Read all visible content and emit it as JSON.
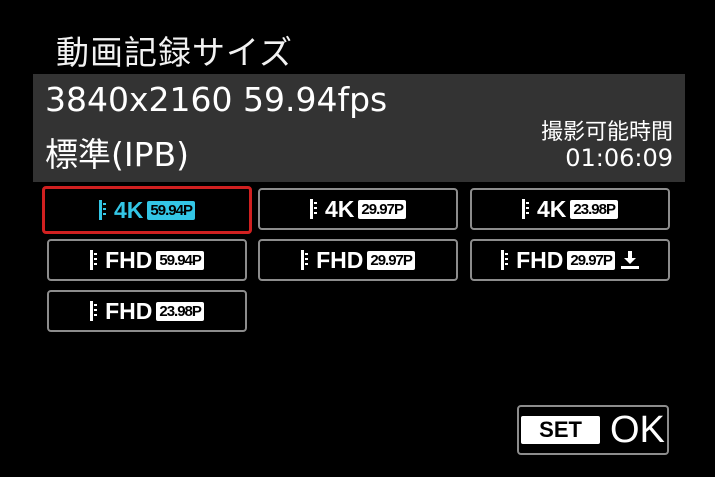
{
  "menu": {
    "title": "動画記録サイズ"
  },
  "info": {
    "resolution_fps": "3840x2160 59.94fps",
    "quality": "標準(IPB)",
    "rec_time_label": "撮影可能時間",
    "rec_time_value": "01:06:09"
  },
  "options": [
    {
      "res": "4K",
      "fps": "59.94P",
      "selected": true
    },
    {
      "res": "4K",
      "fps": "29.97P",
      "selected": false
    },
    {
      "res": "4K",
      "fps": "23.98P",
      "selected": false
    },
    {
      "res": "FHD",
      "fps": "59.94P",
      "selected": false
    },
    {
      "res": "FHD",
      "fps": "29.97P",
      "selected": false
    },
    {
      "res": "FHD",
      "fps": "29.97P",
      "selected": false,
      "icon": "download-icon"
    },
    {
      "res": "FHD",
      "fps": "23.98P",
      "selected": false
    }
  ],
  "footer": {
    "set_label": "SET",
    "ok_label": "OK"
  },
  "colors": {
    "accent": "#33c6e6",
    "selection_border": "#d02020",
    "panel": "#333333"
  }
}
